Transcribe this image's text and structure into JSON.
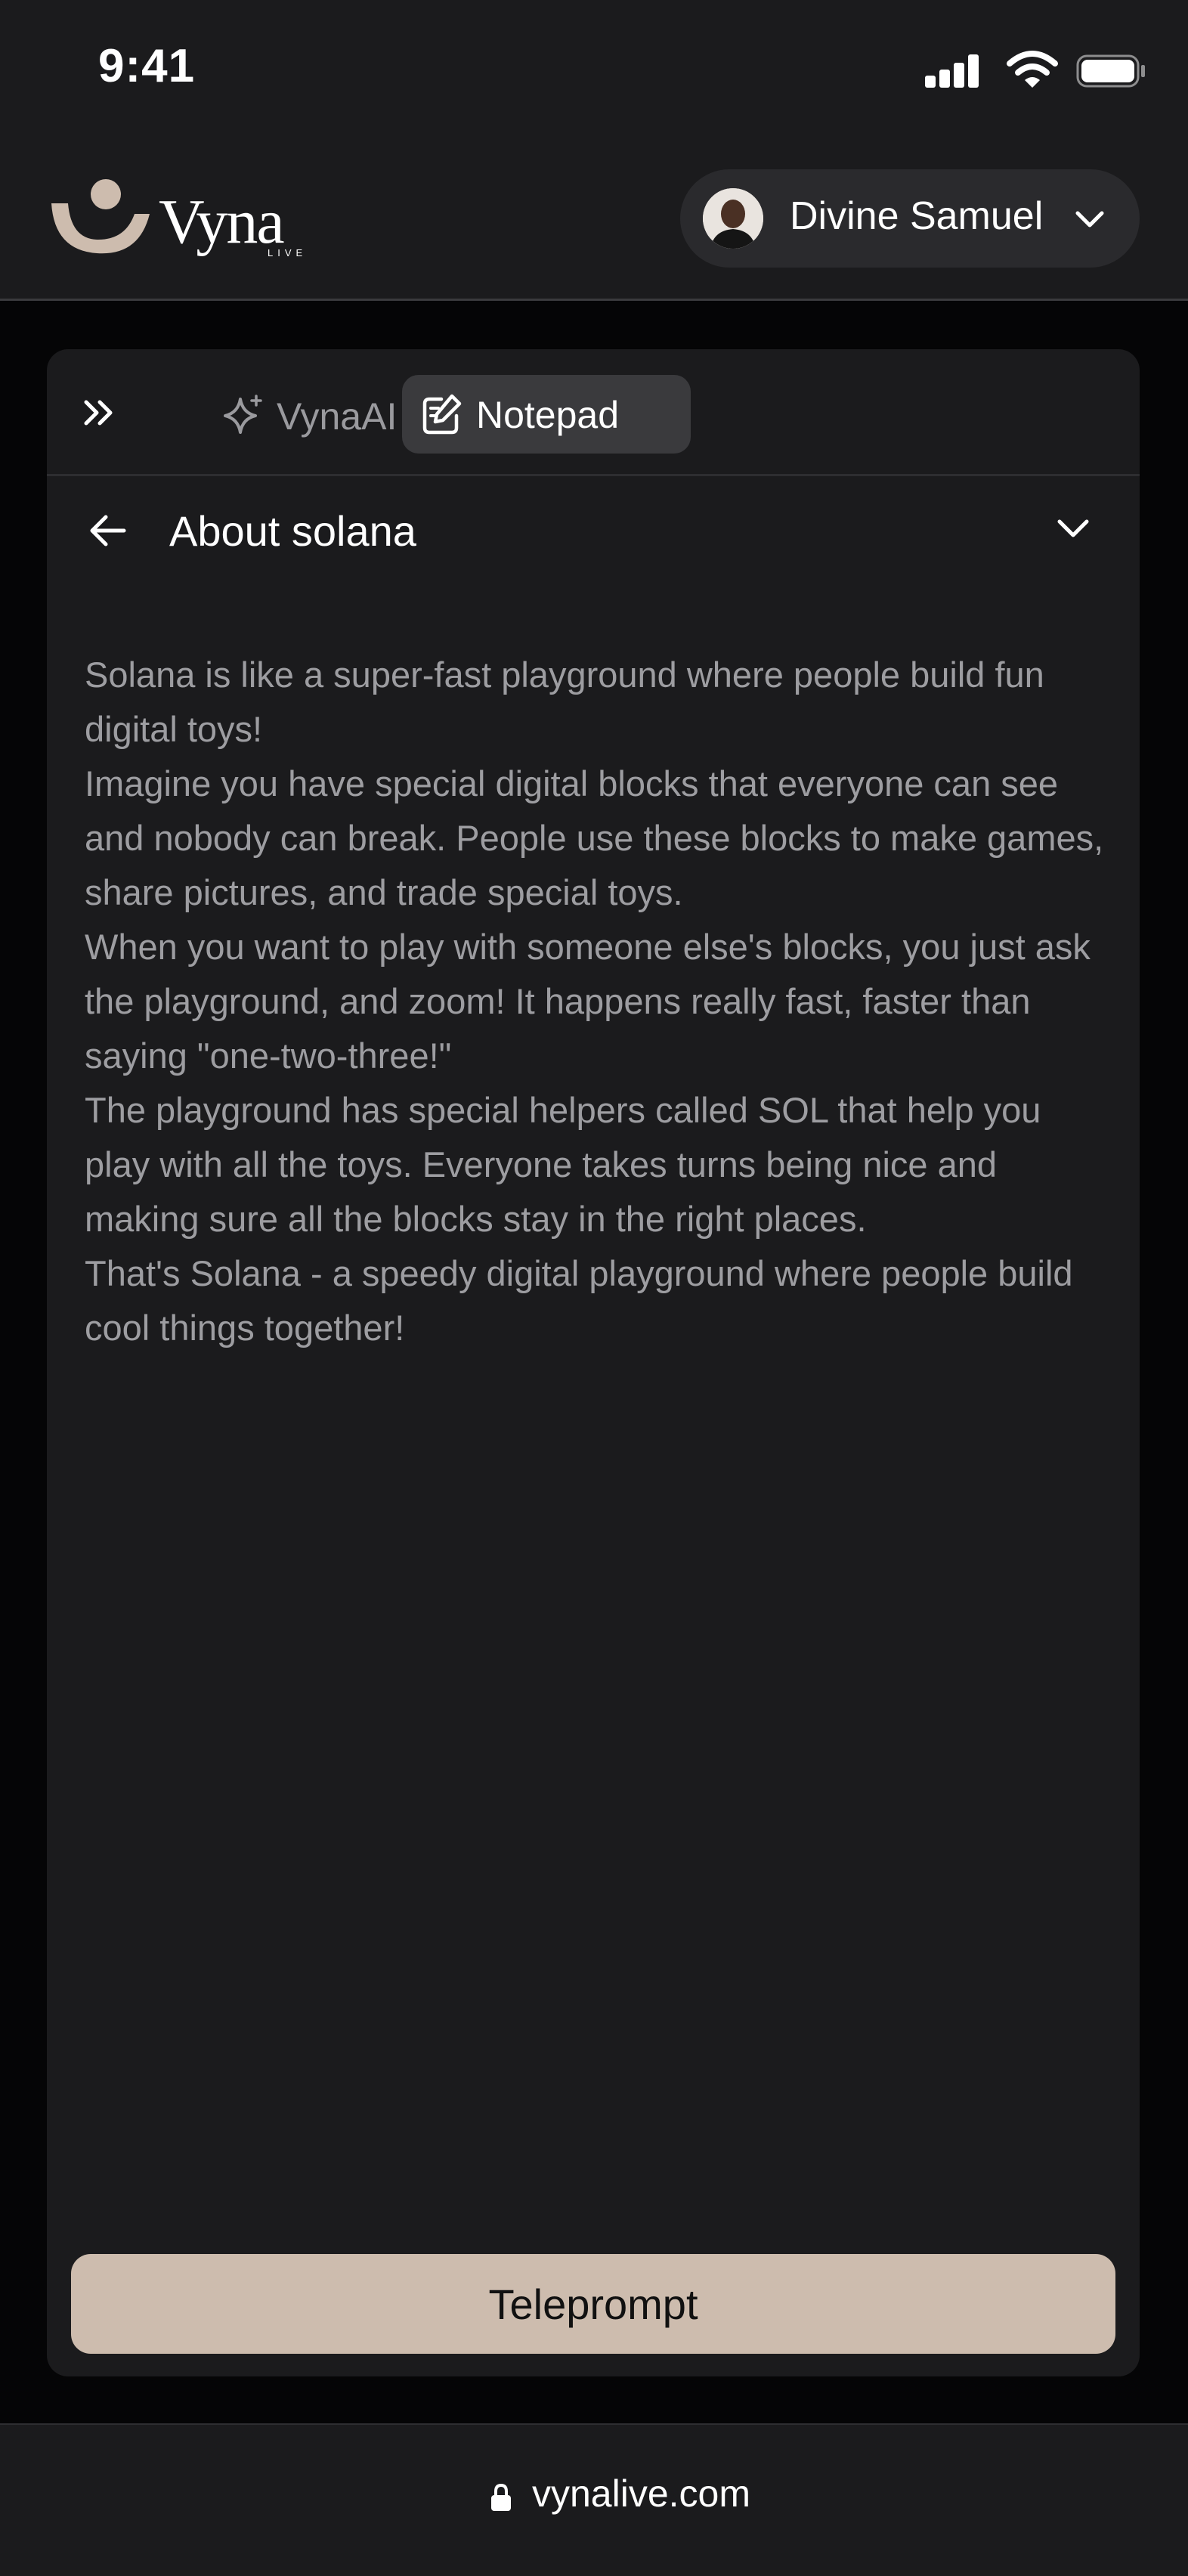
{
  "status_bar": {
    "time": "9:41",
    "icons": [
      "signal-icon",
      "wifi-icon",
      "battery-icon"
    ]
  },
  "header": {
    "logo_text": "Vyna",
    "logo_subtext": "LIVE",
    "user_name": "Divine Samuel",
    "icons": [
      "avatar",
      "chevron-down-icon"
    ]
  },
  "tabs": {
    "items": [
      {
        "label": "VynaAI",
        "icon": "sparkle-icon",
        "active": false
      },
      {
        "label": "Notepad",
        "icon": "notepad-icon",
        "active": true
      }
    ]
  },
  "note": {
    "title": "About solana",
    "paragraphs": [
      "Solana is like a super-fast playground where people build fun digital toys!",
      "Imagine you have special digital blocks that everyone can see and nobody can break. People use these blocks to make games, share pictures, and trade special toys.",
      "When you want to play with someone else's blocks, you just ask the playground, and zoom! It happens really fast, faster than saying \"one-two-three!\"",
      "The playground has special helpers called SOL that help you play with all the toys. Everyone takes turns being nice and making sure all the blocks stay in the right places.",
      "That's Solana - a speedy digital playground where people build cool things together!"
    ]
  },
  "actions": {
    "teleprompt_label": "Teleprompt"
  },
  "browser": {
    "url": "vynalive.com"
  },
  "colors": {
    "background": "#050506",
    "surface": "#1b1b1d",
    "active_tab": "#3a3a3d",
    "body_text": "#9d9da1",
    "accent_button": "#cdbcae"
  }
}
